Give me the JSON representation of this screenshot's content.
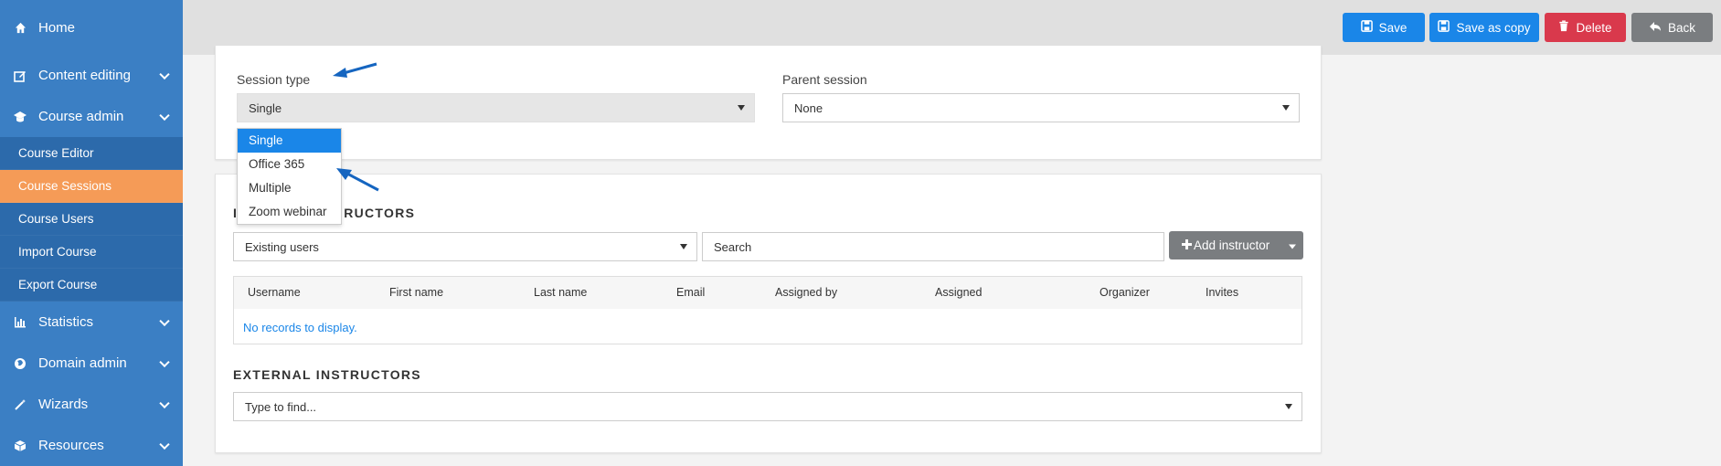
{
  "sidebar": {
    "items": [
      {
        "label": "Home",
        "icon": "home-icon",
        "has_chevron": false
      },
      {
        "label": "Content editing",
        "icon": "edit-icon",
        "has_chevron": true
      },
      {
        "label": "Course admin",
        "icon": "graduation-cap-icon",
        "has_chevron": true
      }
    ],
    "course_admin_sub": [
      {
        "label": "Course Editor",
        "active": false
      },
      {
        "label": "Course Sessions",
        "active": true
      },
      {
        "label": "Course Users",
        "active": false
      },
      {
        "label": "Import Course",
        "active": false
      },
      {
        "label": "Export Course",
        "active": false
      }
    ],
    "lower_items": [
      {
        "label": "Statistics",
        "icon": "bar-chart-icon"
      },
      {
        "label": "Domain admin",
        "icon": "globe-icon"
      },
      {
        "label": "Wizards",
        "icon": "magic-wand-icon"
      },
      {
        "label": "Resources",
        "icon": "cube-icon"
      }
    ]
  },
  "toolbar": {
    "save_label": "Save",
    "save_copy_label": "Save as copy",
    "delete_label": "Delete",
    "back_label": "Back"
  },
  "session": {
    "type_label": "Session type",
    "type_value": "Single",
    "parent_label": "Parent session",
    "parent_value": "None",
    "type_options": [
      "Single",
      "Office 365",
      "Multiple",
      "Zoom webinar"
    ],
    "selected_option": "Single"
  },
  "instructors": {
    "title_visible": "RUCTORS",
    "title_prefix": "I",
    "users_select": "Existing users",
    "search_value": "Search",
    "add_label": "Add instructor",
    "columns": [
      "Username",
      "First name",
      "Last name",
      "Email",
      "Assigned by",
      "Assigned",
      "Organizer",
      "Invites"
    ],
    "empty_text": "No records to display."
  },
  "external": {
    "title": "EXTERNAL INSTRUCTORS",
    "find_placeholder": "Type to find..."
  },
  "colors": {
    "sidebar": "#3b7fc4",
    "sidebar_sub": "#2c6aab",
    "active": "#f59b57",
    "primary": "#1a86e8",
    "danger": "#d9394c",
    "neutral": "#7a7d80"
  }
}
